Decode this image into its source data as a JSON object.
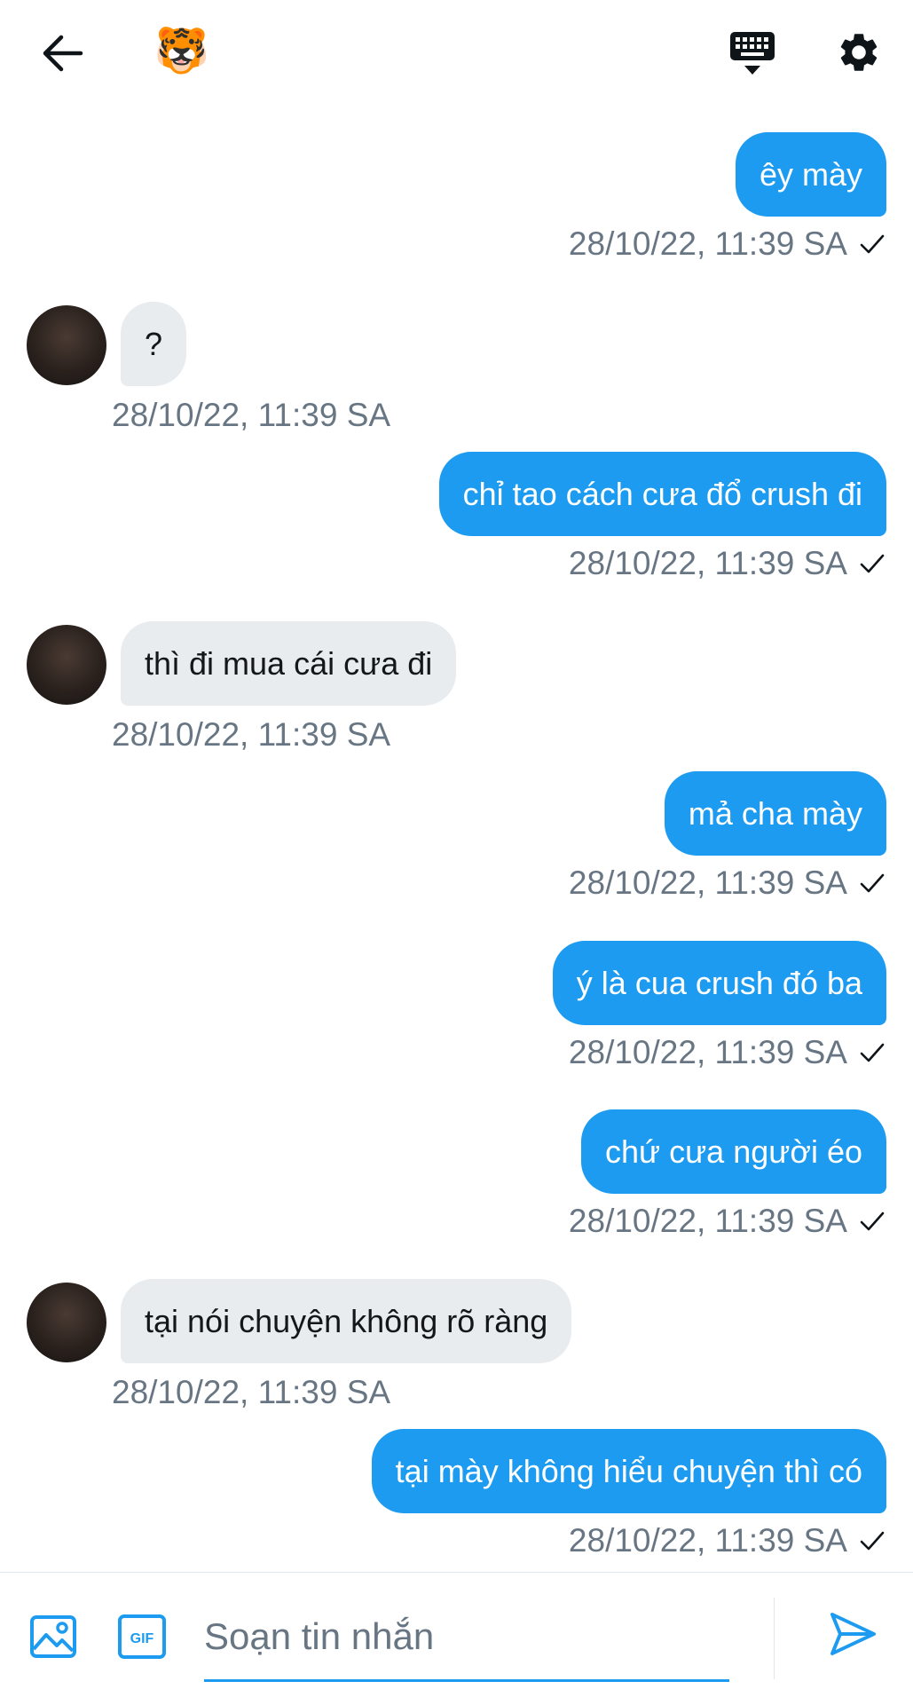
{
  "header": {
    "back_icon": "arrow-left-icon",
    "avatar_emoji": "🐯",
    "keyboard_icon": "keyboard-icon",
    "settings_icon": "gear-icon"
  },
  "messages": [
    {
      "dir": "sent",
      "text": "êy mày",
      "time": "28/10/22, 11:39 SA"
    },
    {
      "dir": "recv",
      "text": "?",
      "time": "28/10/22, 11:39 SA"
    },
    {
      "dir": "sent",
      "text": "chỉ tao cách cưa đổ crush đi",
      "time": "28/10/22, 11:39 SA"
    },
    {
      "dir": "recv",
      "text": "thì đi mua cái cưa đi",
      "time": "28/10/22, 11:39 SA"
    },
    {
      "dir": "sent",
      "text": "mả cha mày",
      "time": "28/10/22, 11:39 SA"
    },
    {
      "dir": "sent",
      "text": "ý là cua crush đó ba",
      "time": "28/10/22, 11:39 SA"
    },
    {
      "dir": "sent",
      "text": "chứ cưa người éo",
      "time": "28/10/22, 11:39 SA"
    },
    {
      "dir": "recv",
      "text": "tại nói chuyện không rõ ràng",
      "time": "28/10/22, 11:39 SA"
    },
    {
      "dir": "sent",
      "text": "tại mày không hiểu chuyện thì có",
      "time": "28/10/22, 11:39 SA"
    }
  ],
  "composer": {
    "placeholder": "Soạn tin nhắn",
    "value": "",
    "image_icon": "image-icon",
    "gif_label": "GIF",
    "send_icon": "send-icon"
  },
  "colors": {
    "accent": "#1d9bf0",
    "received_bubble": "#e9ecef",
    "meta_text": "#687684"
  }
}
